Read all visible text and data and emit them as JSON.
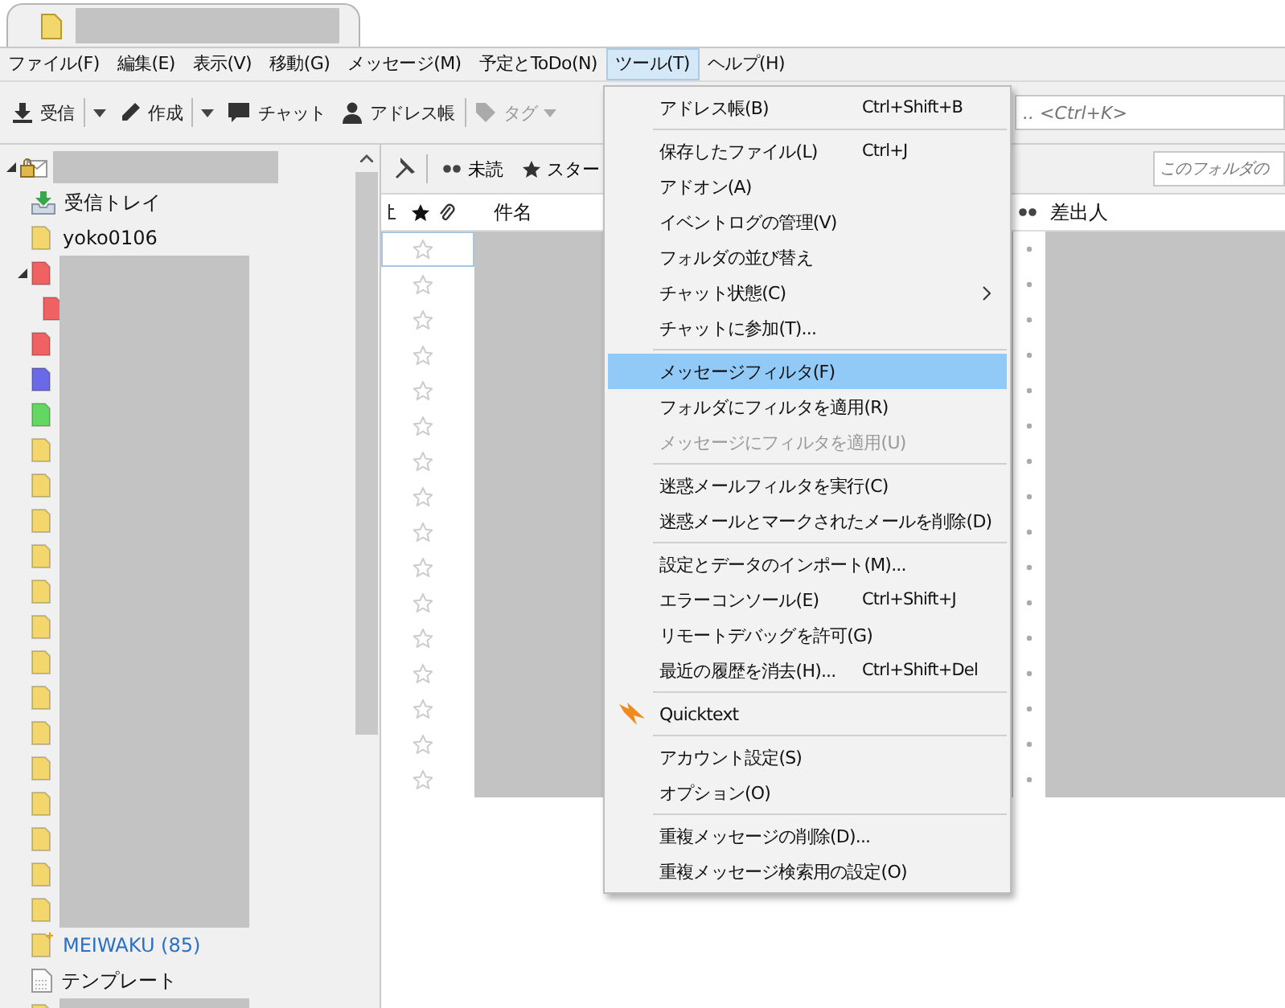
{
  "tabs": [
    {
      "selected": true
    }
  ],
  "menubar": [
    {
      "label": "ファイル(F)",
      "selected": false
    },
    {
      "label": "編集(E)",
      "selected": false
    },
    {
      "label": "表示(V)",
      "selected": false
    },
    {
      "label": "移動(G)",
      "selected": false
    },
    {
      "label": "メッセージ(M)",
      "selected": false
    },
    {
      "label": "予定とToDo(N)",
      "selected": false
    },
    {
      "label": "ツール(T)",
      "selected": true
    },
    {
      "label": "ヘルプ(H)",
      "selected": false
    }
  ],
  "toolbar": [
    {
      "kind": "get",
      "label": "受信",
      "disabled": false,
      "dropdown": true
    },
    {
      "kind": "write",
      "label": "作成",
      "disabled": false,
      "dropdown": true
    },
    {
      "kind": "chat",
      "label": "チャット",
      "disabled": false,
      "dropdown": false
    },
    {
      "kind": "address",
      "label": "アドレス帳",
      "disabled": false,
      "dropdown": false
    },
    {
      "kind": "tag",
      "label": "タグ",
      "disabled": true,
      "dropdown": true
    }
  ],
  "search": {
    "placeholder": ".. <Ctrl+K>"
  },
  "folder_tree": [
    {
      "kind": "account",
      "expanded": true,
      "children": [
        {
          "kind": "inbox",
          "name": "受信トレイ"
        },
        {
          "kind": "folder",
          "color": "#f3d66c",
          "name": "yoko0106"
        },
        {
          "kind": "folder",
          "color": "#f06262",
          "expanded": true,
          "children": [
            {
              "kind": "folder",
              "color": "#f06262"
            }
          ]
        },
        {
          "kind": "folder",
          "color": "#f06262"
        },
        {
          "kind": "folder",
          "color": "#6a6ae8"
        },
        {
          "kind": "folder",
          "color": "#62d862"
        },
        {
          "kind": "folder",
          "color": "#f3d66c"
        },
        {
          "kind": "folder",
          "color": "#f3d66c"
        },
        {
          "kind": "folder",
          "color": "#f3d66c"
        },
        {
          "kind": "folder",
          "color": "#f3d66c"
        },
        {
          "kind": "folder",
          "color": "#f3d66c"
        },
        {
          "kind": "folder",
          "color": "#f3d66c"
        },
        {
          "kind": "folder",
          "color": "#f3d66c"
        },
        {
          "kind": "folder",
          "color": "#f3d66c"
        },
        {
          "kind": "folder",
          "color": "#f3d66c"
        },
        {
          "kind": "folder",
          "color": "#f3d66c"
        },
        {
          "kind": "folder",
          "color": "#f3d66c"
        },
        {
          "kind": "folder",
          "color": "#f3d66c"
        },
        {
          "kind": "folder",
          "color": "#f3d66c"
        },
        {
          "kind": "folder",
          "color": "#f3d66c"
        },
        {
          "kind": "junk",
          "color": "#f3d66c",
          "name": "MEIWAKU (85)",
          "unread": true
        },
        {
          "kind": "templates",
          "name": "テンプレート"
        },
        {
          "kind": "folder",
          "color": "#f3d66c"
        }
      ]
    }
  ],
  "quick_filter": {
    "buttons": [
      {
        "kind": "unread",
        "label": "未読"
      },
      {
        "kind": "starred",
        "label": "スター"
      }
    ],
    "placeholder": "このフォルダの"
  },
  "columns": [
    {
      "kind": "thread"
    },
    {
      "kind": "star"
    },
    {
      "kind": "attachment"
    },
    {
      "kind": "text",
      "label": "件名"
    },
    {
      "kind": "read"
    },
    {
      "kind": "text",
      "label": "差出人"
    }
  ],
  "messages": [
    {
      "starred": false,
      "focused": true
    },
    {
      "starred": false,
      "focused": false
    },
    {
      "starred": false,
      "focused": false
    },
    {
      "starred": false,
      "focused": false
    },
    {
      "starred": false,
      "focused": false
    },
    {
      "starred": false,
      "focused": false
    },
    {
      "starred": false,
      "focused": false
    },
    {
      "starred": false,
      "focused": false
    },
    {
      "starred": false,
      "focused": false
    },
    {
      "starred": false,
      "focused": false
    },
    {
      "starred": false,
      "focused": false
    },
    {
      "starred": false,
      "focused": false
    },
    {
      "starred": false,
      "focused": false
    },
    {
      "starred": false,
      "focused": false
    },
    {
      "starred": false,
      "focused": false
    },
    {
      "starred": false,
      "focused": false
    }
  ],
  "tools_menu": [
    {
      "kind": "item",
      "label": "アドレス帳(B)",
      "shortcut": "Ctrl+Shift+B",
      "selected": false,
      "disabled": false
    },
    {
      "kind": "separator"
    },
    {
      "kind": "item",
      "label": "保存したファイル(L)",
      "shortcut": "Ctrl+J",
      "selected": false,
      "disabled": false
    },
    {
      "kind": "item",
      "label": "アドオン(A)",
      "selected": false,
      "disabled": false
    },
    {
      "kind": "item",
      "label": "イベントログの管理(V)",
      "selected": false,
      "disabled": false
    },
    {
      "kind": "item",
      "label": "フォルダの並び替え",
      "selected": false,
      "disabled": false
    },
    {
      "kind": "submenu",
      "label": "チャット状態(C)",
      "selected": false,
      "disabled": false
    },
    {
      "kind": "item",
      "label": "チャットに参加(T)...",
      "selected": false,
      "disabled": false
    },
    {
      "kind": "separator"
    },
    {
      "kind": "item",
      "label": "メッセージフィルタ(F)",
      "selected": true,
      "disabled": false
    },
    {
      "kind": "item",
      "label": "フォルダにフィルタを適用(R)",
      "selected": false,
      "disabled": false
    },
    {
      "kind": "item",
      "label": "メッセージにフィルタを適用(U)",
      "selected": false,
      "disabled": true
    },
    {
      "kind": "separator"
    },
    {
      "kind": "item",
      "label": "迷惑メールフィルタを実行(C)",
      "selected": false,
      "disabled": false
    },
    {
      "kind": "item",
      "label": "迷惑メールとマークされたメールを削除(D)",
      "selected": false,
      "disabled": false
    },
    {
      "kind": "separator"
    },
    {
      "kind": "item",
      "label": "設定とデータのインポート(M)...",
      "selected": false,
      "disabled": false
    },
    {
      "kind": "item",
      "label": "エラーコンソール(E)",
      "shortcut": "Ctrl+Shift+J",
      "selected": false,
      "disabled": false
    },
    {
      "kind": "item",
      "label": "リモートデバッグを許可(G)",
      "selected": false,
      "disabled": false
    },
    {
      "kind": "item",
      "label": "最近の履歴を消去(H)...",
      "shortcut": "Ctrl+Shift+Del",
      "selected": false,
      "disabled": false
    },
    {
      "kind": "separator"
    },
    {
      "kind": "addon",
      "label": "Quicktext",
      "selected": false,
      "disabled": false
    },
    {
      "kind": "separator"
    },
    {
      "kind": "item",
      "label": "アカウント設定(S)",
      "selected": false,
      "disabled": false
    },
    {
      "kind": "item",
      "label": "オプション(O)",
      "selected": false,
      "disabled": false
    },
    {
      "kind": "separator"
    },
    {
      "kind": "item",
      "label": "重複メッセージの削除(D)...",
      "selected": false,
      "disabled": false
    },
    {
      "kind": "item",
      "label": "重複メッセージ検索用の設定(O)",
      "selected": false,
      "disabled": false
    }
  ]
}
